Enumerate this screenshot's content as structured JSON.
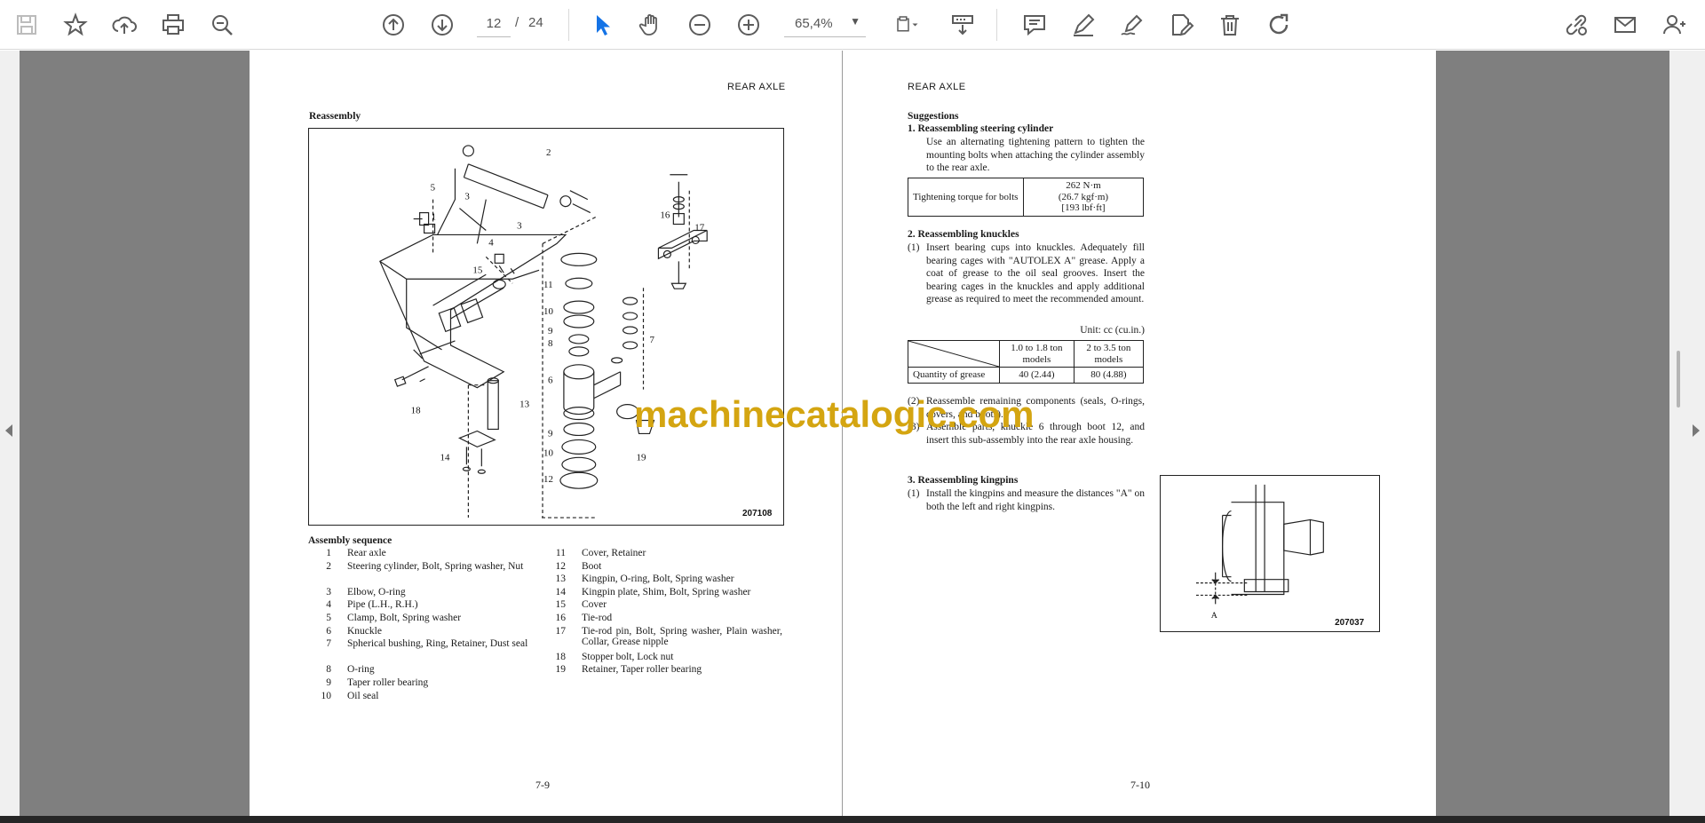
{
  "toolbar": {
    "page_current": "12",
    "page_sep": "/",
    "page_total": "24",
    "zoom": "65,4%"
  },
  "left_page": {
    "header": "REAR AXLE",
    "title": "Reassembly",
    "figure_no": "207108",
    "callouts": [
      "1",
      "2",
      "3",
      "3",
      "4",
      "5",
      "6",
      "7",
      "8",
      "9",
      "10",
      "11",
      "12",
      "13",
      "14",
      "15",
      "16",
      "17",
      "18",
      "19",
      "10",
      "9",
      "12"
    ],
    "sequence_title": "Assembly sequence",
    "sequence": [
      {
        "n": "1",
        "t": "Rear axle"
      },
      {
        "n": "2",
        "t": "Steering cylinder, Bolt, Spring washer, Nut"
      },
      {
        "n": "3",
        "t": "Elbow, O-ring"
      },
      {
        "n": "4",
        "t": "Pipe (L.H., R.H.)"
      },
      {
        "n": "5",
        "t": "Clamp, Bolt, Spring washer"
      },
      {
        "n": "6",
        "t": "Knuckle"
      },
      {
        "n": "7",
        "t": "Spherical bushing, Ring, Retainer, Dust seal"
      },
      {
        "n": "8",
        "t": "O-ring"
      },
      {
        "n": "9",
        "t": "Taper roller bearing"
      },
      {
        "n": "10",
        "t": "Oil seal"
      },
      {
        "n": "11",
        "t": "Cover, Retainer"
      },
      {
        "n": "12",
        "t": "Boot"
      },
      {
        "n": "13",
        "t": "Kingpin, O-ring, Bolt, Spring washer"
      },
      {
        "n": "14",
        "t": "Kingpin plate, Shim, Bolt, Spring washer"
      },
      {
        "n": "15",
        "t": "Cover"
      },
      {
        "n": "16",
        "t": "Tie-rod"
      },
      {
        "n": "17",
        "t": "Tie-rod pin, Bolt, Spring washer, Plain washer, Collar, Grease nipple"
      },
      {
        "n": "18",
        "t": "Stopper bolt, Lock nut"
      },
      {
        "n": "19",
        "t": "Retainer, Taper roller bearing"
      }
    ],
    "page_no": "7-9"
  },
  "right_page": {
    "header": "REAR AXLE",
    "suggestions": "Suggestions",
    "s1_title": "1.  Reassembling steering cylinder",
    "s1_body": "Use an alternating tightening pattern to tighten the mounting bolts when attaching the cylinder assembly to the rear axle.",
    "torque_label": "Tightening torque for bolts",
    "torque_value": "262 N·m\n(26.7 kgf·m)\n[193 lbf·ft]",
    "s2_title": "2.  Reassembling knuckles",
    "s2_p1_num": "(1)",
    "s2_p1": "Insert bearing cups into knuckles. Adequately fill bearing cages with \"AUTOLEX A\" grease. Apply a coat of grease to the oil seal grooves. Insert the bearing cages in the knuckles and apply additional grease as required to meet the recommended amount.",
    "unit": "Unit: cc (cu.in.)",
    "grease_col1": "1.0 to 1.8 ton models",
    "grease_col2": "2 to 3.5 ton models",
    "grease_label": "Quantity of grease",
    "grease_v1": "40 (2.44)",
    "grease_v2": "80 (4.88)",
    "s2_p2_num": "(2)",
    "s2_p2": "Reassemble remaining components (seals, O-rings, covers, and boots).",
    "s2_p3_num": "(3)",
    "s2_p3": "Assemble parts, knuckle 6 through boot 12, and insert this sub-assembly into the rear axle housing.",
    "s3_title": "3.  Reassembling kingpins",
    "s3_p1_num": "(1)",
    "s3_p1": "Install the kingpins and measure the distances \"A\" on both the left and right kingpins.",
    "figure_no": "207037",
    "figure_label": "A",
    "page_no": "7-10"
  },
  "watermark": "machinecatalogic.com",
  "colors": {
    "toolbar_icon": "#5c5c5c",
    "select_active": "#1473e6",
    "doc_bg": "#7f7f7f",
    "watermark": "#d4a511"
  }
}
